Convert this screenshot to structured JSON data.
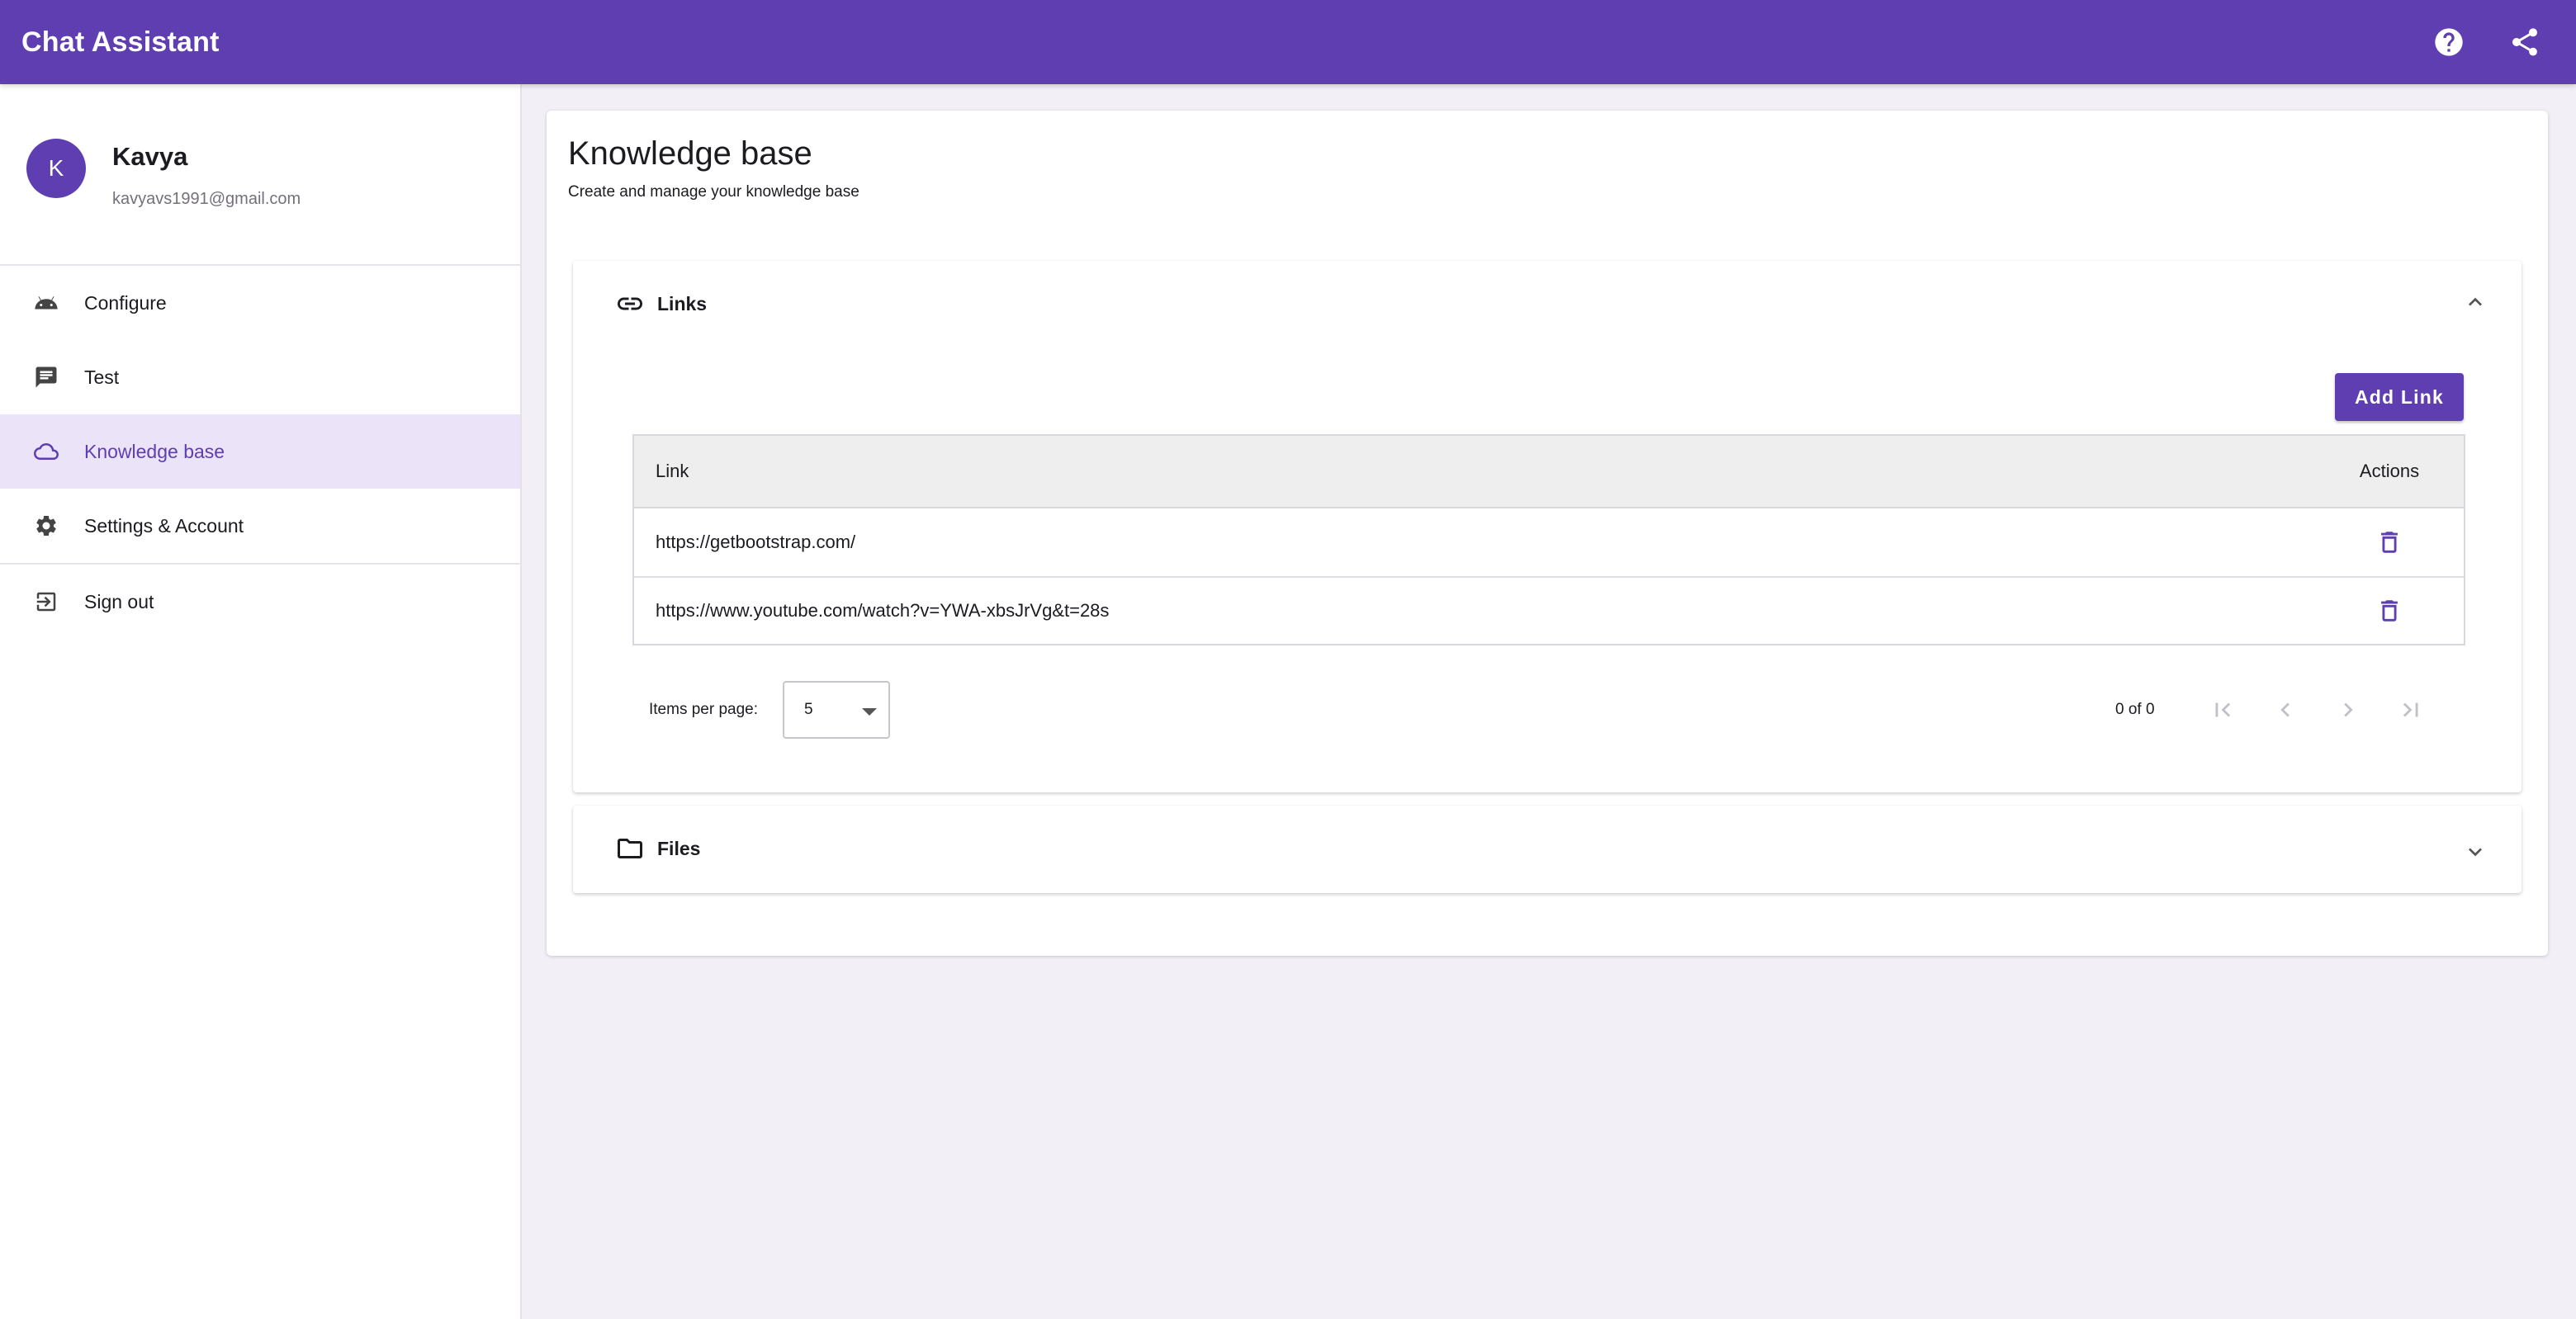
{
  "app": {
    "title": "Chat Assistant"
  },
  "topbar": {
    "help_icon": "help-circle-icon",
    "share_icon": "share-icon"
  },
  "user": {
    "initial": "K",
    "name": "Kavya",
    "email": "kavyavs1991@gmail.com"
  },
  "sidebar": {
    "items": [
      {
        "label": "Configure",
        "icon": "android-icon",
        "active": false
      },
      {
        "label": "Test",
        "icon": "chat-icon",
        "active": false
      },
      {
        "label": "Knowledge base",
        "icon": "cloud-icon",
        "active": true
      },
      {
        "label": "Settings & Account",
        "icon": "gear-icon",
        "active": false
      },
      {
        "label": "Sign out",
        "icon": "logout-icon",
        "active": false
      }
    ]
  },
  "main": {
    "title": "Knowledge base",
    "subtitle": "Create and manage your knowledge base",
    "links_panel": {
      "title": "Links",
      "expanded": true,
      "add_button": "Add Link",
      "columns": {
        "link": "Link",
        "actions": "Actions"
      },
      "rows": [
        {
          "link": "https://getbootstrap.com/"
        },
        {
          "link": "https://www.youtube.com/watch?v=YWA-xbsJrVg&t=28s"
        }
      ],
      "paginator": {
        "items_per_page_label": "Items per page:",
        "items_per_page_value": "5",
        "range_label": "0 of 0"
      }
    },
    "files_panel": {
      "title": "Files",
      "expanded": false
    }
  },
  "colors": {
    "primary": "#5e3eb0",
    "active_bg": "#ebe3f8",
    "page_bg": "#f3eff7"
  }
}
